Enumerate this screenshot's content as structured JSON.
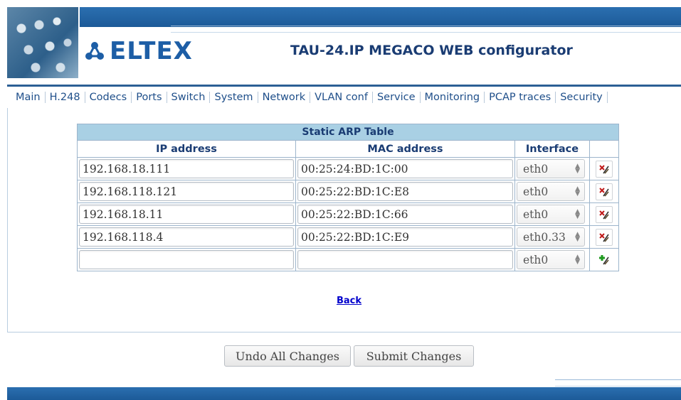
{
  "header": {
    "logo_text": "ELTEX",
    "title": "TAU-24.IP MEGACO WEB configurator"
  },
  "menu": {
    "items": [
      {
        "label": "Main"
      },
      {
        "label": "H.248"
      },
      {
        "label": "Codecs"
      },
      {
        "label": "Ports"
      },
      {
        "label": "Switch"
      },
      {
        "label": "System"
      },
      {
        "label": "Network"
      },
      {
        "label": "VLAN conf"
      },
      {
        "label": "Service"
      },
      {
        "label": "Monitoring"
      },
      {
        "label": "PCAP traces"
      },
      {
        "label": "Security"
      }
    ]
  },
  "arp_table": {
    "caption": "Static ARP Table",
    "columns": {
      "ip": "IP address",
      "mac": "MAC address",
      "iface": "Interface"
    },
    "rows": [
      {
        "ip": "192.168.18.111",
        "mac": "00:25:24:BD:1C:00",
        "iface": "eth0",
        "action": "delete-icon"
      },
      {
        "ip": "192.168.118.121",
        "mac": "00:25:22:BD:1C:E8",
        "iface": "eth0",
        "action": "delete-icon"
      },
      {
        "ip": "192.168.18.11",
        "mac": "00:25:22:BD:1C:66",
        "iface": "eth0",
        "action": "delete-icon"
      },
      {
        "ip": "192.168.118.4",
        "mac": "00:25:22:BD:1C:E9",
        "iface": "eth0.33",
        "action": "delete-icon"
      },
      {
        "ip": "",
        "mac": "",
        "iface": "eth0",
        "action": "add-icon"
      }
    ]
  },
  "back_link": "Back",
  "buttons": {
    "undo": "Undo All Changes",
    "submit": "Submit Changes"
  }
}
